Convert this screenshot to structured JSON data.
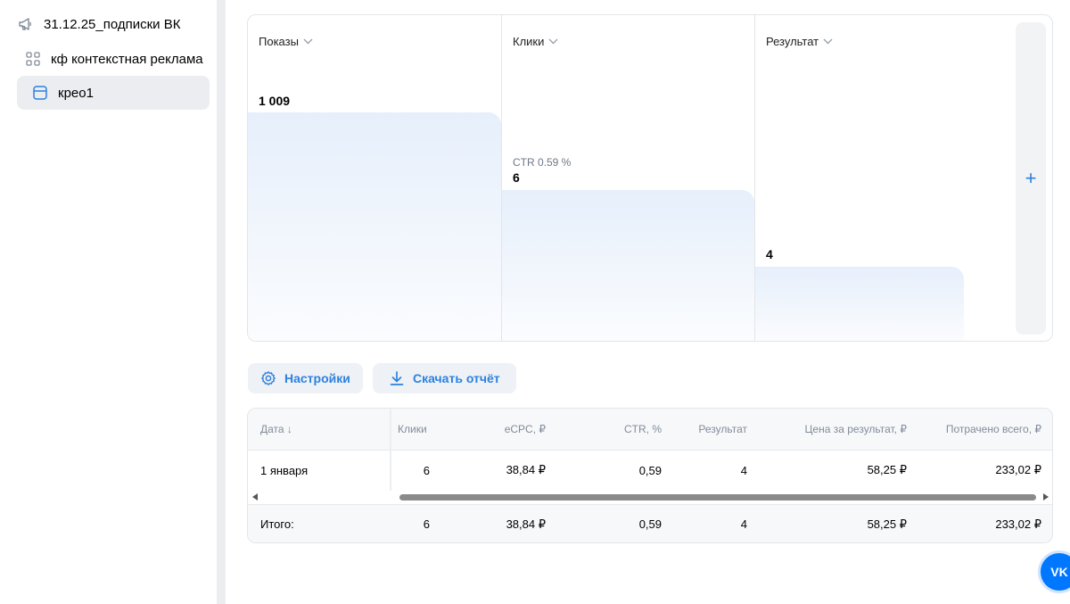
{
  "sidebar": {
    "items": [
      {
        "label": "31.12.25_подписки ВК",
        "icon": "megaphone-icon"
      },
      {
        "label": "кф контекстная реклама",
        "icon": "grid-icon"
      },
      {
        "label": "крео1",
        "icon": "ad-card-icon"
      }
    ]
  },
  "funnel": {
    "columns": [
      {
        "label": "Показы",
        "value": "1 009",
        "sub": ""
      },
      {
        "label": "Клики",
        "value": "6",
        "sub": "CTR 0.59 %"
      },
      {
        "label": "Результат",
        "value": "4",
        "sub": ""
      }
    ],
    "levels": [
      1009,
      6,
      4
    ],
    "add_label": "+"
  },
  "toolbar": {
    "settings_label": "Настройки",
    "download_label": "Скачать отчёт"
  },
  "table": {
    "headers": [
      "Дата ↓",
      "Клики",
      "eCPC, ₽",
      "CTR, %",
      "Результат",
      "Цена за результат, ₽",
      "Потрачено всего, ₽"
    ],
    "rows": [
      [
        "1 января",
        "6",
        "38,84 ₽",
        "0,59",
        "4",
        "58,25 ₽",
        "233,02 ₽"
      ]
    ],
    "total": [
      "Итого:",
      "6",
      "38,84 ₽",
      "0,59",
      "4",
      "58,25 ₽",
      "233,02 ₽"
    ]
  },
  "colors": {
    "accent": "#2d81e0",
    "vk_blue": "#0077ff"
  },
  "fab": {
    "label": "VK"
  }
}
